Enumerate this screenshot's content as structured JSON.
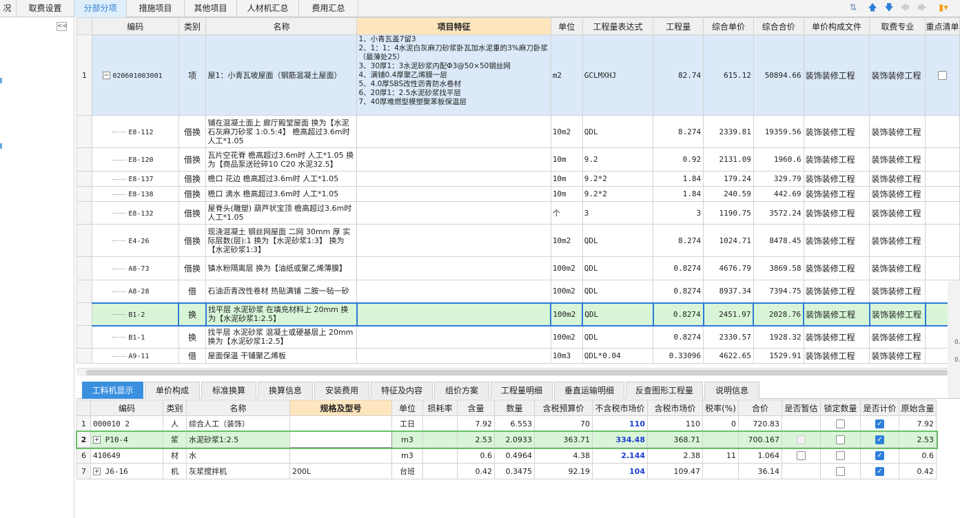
{
  "tabs": [
    "况",
    "取费设置",
    "分部分项",
    "措施项目",
    "其他项目",
    "人材机汇总",
    "费用汇总"
  ],
  "toolbar_icons": [
    "move-first-icon",
    "move-up-icon",
    "move-down-icon",
    "nav-back-icon",
    "nav-forward-icon",
    "settings-icon"
  ],
  "collapse_label": "<<",
  "main_table": {
    "headers": [
      "编码",
      "类别",
      "名称",
      "项目特征",
      "单位",
      "工程量表达式",
      "工程量",
      "综合单价",
      "综合合价",
      "单价构成文件",
      "取费专业",
      "重点清单"
    ],
    "rows": [
      {
        "no": "1",
        "code": "020601003001",
        "type": "项",
        "name": "屋1：小青瓦坡屋面（钢筋混凝土屋面）",
        "feature": "1、小青瓦盖7留3\n2、1：1：4水泥白灰麻刀砂浆卧瓦加水泥重的3%麻刀卧浆（最薄处25）\n3、30厚1：3水泥砂浆内配Φ3@50×50钢丝网\n4、满铺0.4厚聚乙烯膜一层\n5、4.0厚SBS改性沥青防水卷材\n6、20厚1：2.5水泥砂浆找平层\n7、40厚难燃型模塑聚苯板保温层",
        "unit": "m2",
        "expr": "GCLMXHJ",
        "qty": "82.74",
        "price": "615.12",
        "total": "50894.66",
        "file": "装饰装修工程",
        "fee": "装饰装修工程"
      },
      {
        "no": "",
        "code": "E8-112",
        "type": "借换",
        "name": "铺在混凝土面上 廊厅殿堂屋面  换为【水泥石灰麻刀砂浆 1:0.5:4】  檐高超过3.6m时 人工*1.05",
        "feature": "",
        "unit": "10m2",
        "expr": "QDL",
        "qty": "8.274",
        "price": "2339.81",
        "total": "19359.56",
        "file": "装饰装修工程",
        "fee": "装饰装修工程"
      },
      {
        "no": "",
        "code": "E8-120",
        "type": "借换",
        "name": "瓦片空花脊  檐高超过3.6m时 人工*1.05  换为【商品泵送砼碎10 C20 水泥32.5】",
        "feature": "",
        "unit": "10m",
        "expr": "9.2",
        "qty": "0.92",
        "price": "2131.09",
        "total": "1960.6",
        "file": "装饰装修工程",
        "fee": "装饰装修工程"
      },
      {
        "no": "",
        "code": "E8-137",
        "type": "借换",
        "name": "檐口 花边  檐高超过3.6m时 人工*1.05",
        "feature": "",
        "unit": "10m",
        "expr": "9.2*2",
        "qty": "1.84",
        "price": "179.24",
        "total": "329.79",
        "file": "装饰装修工程",
        "fee": "装饰装修工程"
      },
      {
        "no": "",
        "code": "E8-138",
        "type": "借换",
        "name": "檐口 滴水  檐高超过3.6m时 人工*1.05",
        "feature": "",
        "unit": "10m",
        "expr": "9.2*2",
        "qty": "1.84",
        "price": "240.59",
        "total": "442.69",
        "file": "装饰装修工程",
        "fee": "装饰装修工程"
      },
      {
        "no": "",
        "code": "E8-132",
        "type": "借换",
        "name": "屋脊头(雕塑) 葫芦状宝顶  檐高超过3.6m时 人工*1.05",
        "feature": "",
        "unit": "个",
        "expr": "3",
        "qty": "3",
        "price": "1190.75",
        "total": "3572.24",
        "file": "装饰装修工程",
        "fee": "装饰装修工程"
      },
      {
        "no": "",
        "code": "E4-26",
        "type": "借换",
        "name": "现浇混凝土 钢丝网屋面 二网 30mm 厚  实际层数(层):1  换为【水泥砂浆1:3】  换为【水泥砂浆1:3】",
        "feature": "",
        "unit": "10m2",
        "expr": "QDL",
        "qty": "8.274",
        "price": "1024.71",
        "total": "8478.45",
        "file": "装饰装修工程",
        "fee": "装饰装修工程"
      },
      {
        "no": "",
        "code": "A8-73",
        "type": "借换",
        "name": "镇水粉隔离层  换为【油纸或聚乙烯薄膜】",
        "feature": "",
        "unit": "100m2",
        "expr": "QDL",
        "qty": "0.8274",
        "price": "4676.79",
        "total": "3869.58",
        "file": "装饰装修工程",
        "fee": "装饰装修工程"
      },
      {
        "no": "",
        "code": "A8-28",
        "type": "借",
        "name": "石油沥青改性卷材 热贴满铺 二胺一毡一砂",
        "feature": "",
        "unit": "100m2",
        "expr": "QDL",
        "qty": "0.8274",
        "price": "8937.34",
        "total": "7394.75",
        "file": "装饰装修工程",
        "fee": "装饰装修工程"
      },
      {
        "no": "",
        "code": "B1-2",
        "type": "换",
        "name": "找平层 水泥砂浆 在填充材料上 20mm  换为【水泥砂浆1:2.5】",
        "feature": "",
        "unit": "100m2",
        "expr": "QDL",
        "qty": "0.8274",
        "price": "2451.97",
        "total": "2028.76",
        "file": "装饰装修工程",
        "fee": "装饰装修工程"
      },
      {
        "no": "",
        "code": "B1-1",
        "type": "换",
        "name": "找平层 水泥砂浆 混凝土或硬基层上 20mm  换为【水泥砂浆1:2.5】",
        "feature": "",
        "unit": "100m2",
        "expr": "QDL",
        "qty": "0.8274",
        "price": "2330.57",
        "total": "1928.32",
        "file": "装饰装修工程",
        "fee": "装饰装修工程"
      },
      {
        "no": "",
        "code": "A9-11",
        "type": "借",
        "name": "屋面保温 干铺聚乙烯板",
        "feature": "",
        "unit": "10m3",
        "expr": "QDL*0.04",
        "qty": "0.33096",
        "price": "4622.65",
        "total": "1529.91",
        "file": "装饰装修工程",
        "fee": "装饰装修工程"
      }
    ]
  },
  "bottom_tabs": [
    "工料机显示",
    "单价构成",
    "标准换算",
    "换算信息",
    "安装费用",
    "特征及内容",
    "组价方案",
    "工程量明细",
    "垂直运输明细",
    "反查图形工程量",
    "说明信息"
  ],
  "sub_table": {
    "headers": [
      "编码",
      "类别",
      "名称",
      "规格及型号",
      "单位",
      "损耗率",
      "含量",
      "数量",
      "含税预算价",
      "不含税市场价",
      "含税市场价",
      "税率(%)",
      "合价",
      "是否暂估",
      "锁定数量",
      "是否计价",
      "原始含量"
    ],
    "rows": [
      {
        "no": "1",
        "code": "000010 2",
        "type": "人",
        "name": "综合人工（装饰）",
        "spec": "",
        "unit": "工日",
        "loss": "",
        "content": "7.92",
        "qty": "6.553",
        "budget": "70",
        "market": "110",
        "taxmarket": "110",
        "rate": "0",
        "total": "720.83",
        "orig": "7.92"
      },
      {
        "no": "2",
        "code": "P10-4",
        "type": "浆",
        "name": "水泥砂浆1:2.5",
        "spec": "",
        "unit": "m3",
        "loss": "",
        "content": "2.53",
        "qty": "2.0933",
        "budget": "363.71",
        "market": "334.48",
        "taxmarket": "368.71",
        "rate": "",
        "total": "700.167",
        "orig": "2.53"
      },
      {
        "no": "6",
        "code": "410649",
        "type": "材",
        "name": "水",
        "spec": "",
        "unit": "m3",
        "loss": "",
        "content": "0.6",
        "qty": "0.4964",
        "budget": "4.38",
        "market": "2.144",
        "taxmarket": "2.38",
        "rate": "11",
        "total": "1.064",
        "orig": "0.6"
      },
      {
        "no": "7",
        "code": "J6-16",
        "type": "机",
        "name": "灰浆搅拌机",
        "spec": "200L",
        "unit": "台班",
        "loss": "",
        "content": "0.42",
        "qty": "0.3475",
        "budget": "92.19",
        "market": "104",
        "taxmarket": "109.47",
        "rate": "",
        "total": "36.14",
        "orig": "0.42"
      }
    ]
  },
  "side_float": {
    "values": [
      "0.",
      "0."
    ]
  }
}
